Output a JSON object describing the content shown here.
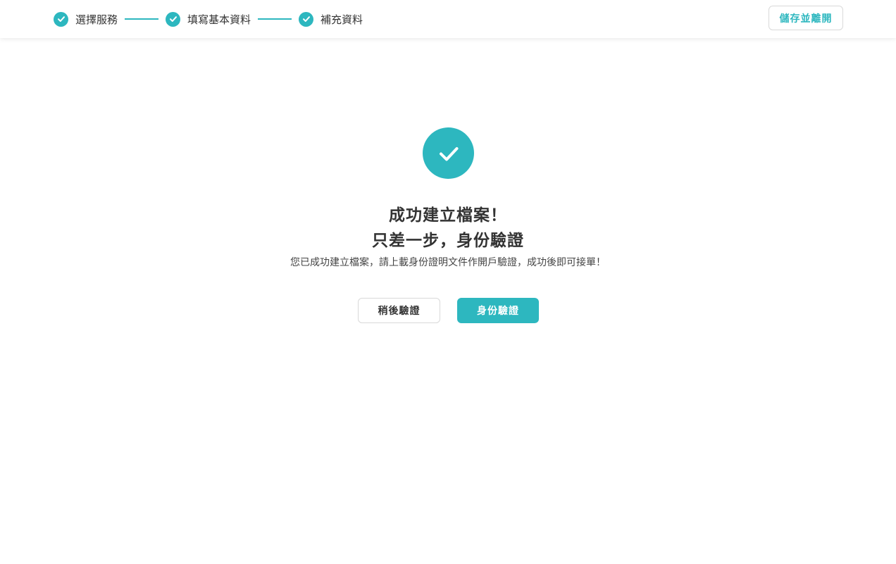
{
  "colors": {
    "accent": "#2db7bf",
    "text": "#333333",
    "border": "#d9d9d9",
    "background": "#ffffff"
  },
  "header": {
    "steps": [
      {
        "label": "選擇服務",
        "icon": "check-circle-icon",
        "status": "completed"
      },
      {
        "label": "填寫基本資料",
        "icon": "check-circle-icon",
        "status": "completed"
      },
      {
        "label": "補充資料",
        "icon": "check-circle-icon",
        "status": "completed"
      }
    ],
    "save_exit_label": "儲存並離開"
  },
  "main": {
    "icon": "check-circle-icon",
    "title_line1": "成功建立檔案！",
    "title_line2": "只差一步，身份驗證",
    "description": "您已成功建立檔案，請上載身份證明文件作開戶驗證，成功後即可接單！",
    "later_button_label": "稍後驗證",
    "verify_button_label": "身份驗證"
  }
}
